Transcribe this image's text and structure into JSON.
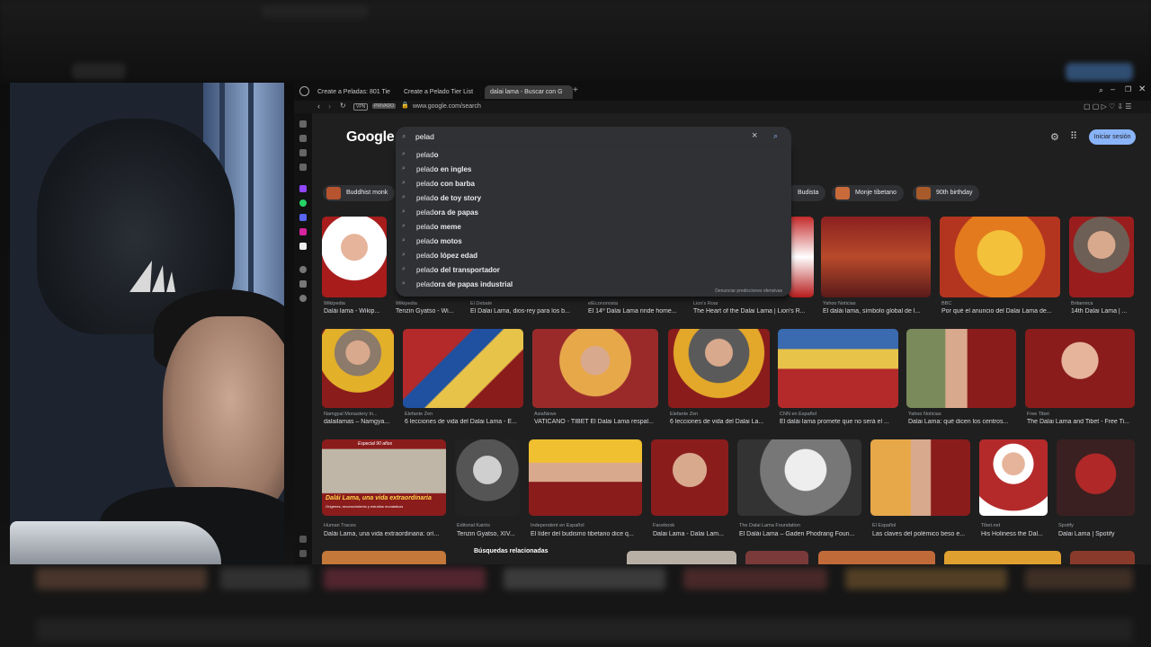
{
  "browser": {
    "tabs": [
      {
        "label": "Create a Peladas: 801 Tie"
      },
      {
        "label": "Create a Pelado Tier List"
      },
      {
        "label": "dalai lama - Buscar con G"
      }
    ],
    "url": "www.google.com/search",
    "url_tags": [
      "VPN",
      "PRIVADO"
    ]
  },
  "google": {
    "logo": "Google",
    "query": "pelad",
    "signin_label": "Iniciar sesión",
    "report_text": "Denunciar predicciones ofensivas",
    "suggestions": [
      {
        "prefix": "pelad",
        "rest": "o"
      },
      {
        "prefix": "pelad",
        "rest": "o en ingles"
      },
      {
        "prefix": "pelad",
        "rest": "o con barba"
      },
      {
        "prefix": "pelad",
        "rest": "o de toy story"
      },
      {
        "prefix": "pelad",
        "rest": "ora de papas"
      },
      {
        "prefix": "pelad",
        "rest": "o meme"
      },
      {
        "prefix": "pelad",
        "rest": "o motos"
      },
      {
        "prefix": "pelad",
        "rest": "o lópez edad"
      },
      {
        "prefix": "pelad",
        "rest": "o del transportador"
      },
      {
        "prefix": "pelad",
        "rest": "ora de papas industrial"
      }
    ],
    "chips": [
      "Buddhist monk",
      "Budista",
      "Monje tibetano",
      "90th birthday"
    ],
    "row1": [
      {
        "source": "Wikipedia",
        "caption": "Dalái lama - Wikip..."
      },
      {
        "source": "Wikipedia",
        "caption": "Tenzin Gyatso - Wi..."
      },
      {
        "source": "El Debate",
        "caption": "El Dalai Lama, dios-rey para los b..."
      },
      {
        "source": "elEconomista",
        "caption": "El 14º Dalai Lama rinde home..."
      },
      {
        "source": "Lion's Roar",
        "caption": "The Heart of the Dalai Lama | Lion's R..."
      },
      {
        "source": "Yahoo Noticias",
        "caption": "El dalái lama, símbolo global de l..."
      },
      {
        "source": "BBC",
        "caption": "Por qué el anuncio del Dalai Lama de..."
      },
      {
        "source": "Britannica",
        "caption": "14th Dalai Lama | ..."
      }
    ],
    "row2": [
      {
        "source": "Namgyal Monastery In...",
        "caption": "dalailamas – Namgya..."
      },
      {
        "source": "Elefante Zen",
        "caption": "6 lecciones de vida del Dalai Lama - E..."
      },
      {
        "source": "AsiaNews",
        "caption": "VATICANO - TÍBET El Dalai Lama respal..."
      },
      {
        "source": "Elefante Zen",
        "caption": "6 lecciones de vida del Dalai La..."
      },
      {
        "source": "CNN en Español",
        "caption": "El dalái lama promete que no será el ..."
      },
      {
        "source": "Yahoo Noticias",
        "caption": "Dalai Lama: qué dicen los centros..."
      },
      {
        "source": "Free Tibet",
        "caption": "The Dalai Lama and Tibet - Free Ti..."
      }
    ],
    "row3": [
      {
        "source": "Human Traces",
        "caption": "Dalái Lama, una vida extraordinaria: orí..."
      },
      {
        "source": "Editorial Kairós",
        "caption": "Tenzin Gyatso, XIV..."
      },
      {
        "source": "Independent en Español",
        "caption": "El líder del budismo tibetano dice q..."
      },
      {
        "source": "Facebook",
        "caption": "Dalai Lama - Dalai Lam..."
      },
      {
        "source": "The Dalai Lama Foundation",
        "caption": "El Dalái Lama – Gaden Phodrang Foun..."
      },
      {
        "source": "El Español",
        "caption": "Las claves del polémico beso e..."
      },
      {
        "source": "Tibet.net",
        "caption": "His Holiness the Dal..."
      },
      {
        "source": "Spotify",
        "caption": "Dalai Lama | Spotify"
      }
    ],
    "book_title": "Dalái Lama, una vida extraordinaria",
    "book_subtitle": "Orígenes, reconocimiento y estudios monásticos",
    "book_banner": "Especial 90 años",
    "related_label": "Búsquedas relacionadas"
  },
  "colors": {
    "accent": "#8ab4f8",
    "bg": "#1f1f1f",
    "surface": "#303134"
  }
}
